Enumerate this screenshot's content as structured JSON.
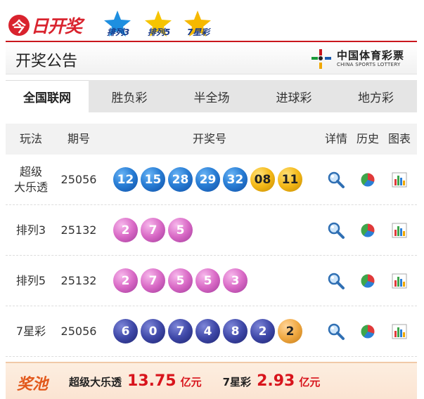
{
  "brand": {
    "mark": "今",
    "text": "日开奖"
  },
  "game_logos": [
    {
      "name": "排列3",
      "color": "#1e8fe0"
    },
    {
      "name": "排列5",
      "color": "#f6c400"
    },
    {
      "name": "7星彩",
      "color": "#f6b800"
    }
  ],
  "notice": {
    "title": "开奖公告",
    "org_cn": "中国体育彩票",
    "org_en": "CHINA SPORTS LOTTERY"
  },
  "tabs": [
    {
      "label": "全国联网",
      "active": true
    },
    {
      "label": "胜负彩",
      "active": false
    },
    {
      "label": "半全场",
      "active": false
    },
    {
      "label": "进球彩",
      "active": false
    },
    {
      "label": "地方彩",
      "active": false
    }
  ],
  "table": {
    "headers": {
      "play": "玩法",
      "issue": "期号",
      "numbers": "开奖号",
      "detail": "详情",
      "history": "历史",
      "chart": "图表"
    },
    "rows": [
      {
        "play": "超级\n大乐透",
        "issue": "25056",
        "balls": [
          {
            "n": "12",
            "c": "blue"
          },
          {
            "n": "15",
            "c": "blue"
          },
          {
            "n": "28",
            "c": "blue"
          },
          {
            "n": "29",
            "c": "blue"
          },
          {
            "n": "32",
            "c": "blue"
          },
          {
            "n": "08",
            "c": "gold"
          },
          {
            "n": "11",
            "c": "gold"
          }
        ]
      },
      {
        "play": "排列3",
        "issue": "25132",
        "balls": [
          {
            "n": "2",
            "c": "pink"
          },
          {
            "n": "7",
            "c": "pink"
          },
          {
            "n": "5",
            "c": "pink"
          }
        ]
      },
      {
        "play": "排列5",
        "issue": "25132",
        "balls": [
          {
            "n": "2",
            "c": "pink"
          },
          {
            "n": "7",
            "c": "pink"
          },
          {
            "n": "5",
            "c": "pink"
          },
          {
            "n": "5",
            "c": "pink"
          },
          {
            "n": "3",
            "c": "pink"
          }
        ]
      },
      {
        "play": "7星彩",
        "issue": "25056",
        "balls": [
          {
            "n": "6",
            "c": "navy"
          },
          {
            "n": "0",
            "c": "navy"
          },
          {
            "n": "7",
            "c": "navy"
          },
          {
            "n": "4",
            "c": "navy"
          },
          {
            "n": "8",
            "c": "navy"
          },
          {
            "n": "2",
            "c": "navy"
          },
          {
            "n": "2",
            "c": "orange"
          }
        ]
      }
    ]
  },
  "jackpot": {
    "title": "奖池",
    "items": [
      {
        "label": "超级大乐透",
        "amount": "13.75",
        "unit": "亿元"
      },
      {
        "label": "7星彩",
        "amount": "2.93",
        "unit": "亿元"
      }
    ]
  }
}
